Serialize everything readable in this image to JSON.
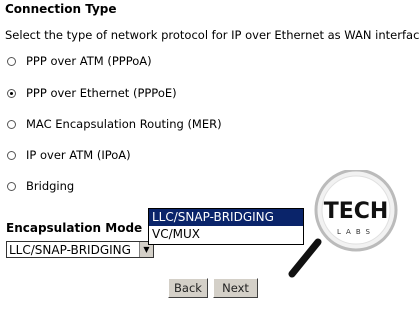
{
  "header": {
    "title": "Connection Type",
    "description": "Select the type of network protocol for IP over Ethernet as WAN interface"
  },
  "options": [
    {
      "label": "PPP over ATM (PPPoA)",
      "checked": false
    },
    {
      "label": "PPP over Ethernet (PPPoE)",
      "checked": true
    },
    {
      "label": "MAC Encapsulation Routing (MER)",
      "checked": false
    },
    {
      "label": "IP over ATM (IPoA)",
      "checked": false
    },
    {
      "label": "Bridging",
      "checked": false
    }
  ],
  "encapsulation": {
    "label": "Encapsulation Mode",
    "selected": "LLC/SNAP-BRIDGING",
    "menu": [
      "LLC/SNAP-BRIDGING",
      "VC/MUX"
    ]
  },
  "buttons": {
    "back": "Back",
    "next": "Next"
  },
  "watermark": {
    "line1": "TECH",
    "line2": "LABS",
    "icon": "magnifier-icon"
  }
}
